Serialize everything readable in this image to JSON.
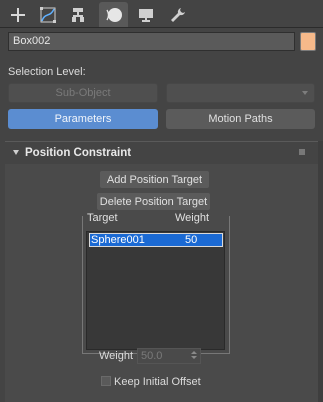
{
  "tabs": [
    {
      "name": "create",
      "icon": "plus-icon",
      "active": false
    },
    {
      "name": "modify",
      "icon": "modify-curve-icon",
      "active": false
    },
    {
      "name": "hierarchy",
      "icon": "hierarchy-icon",
      "active": false
    },
    {
      "name": "motion",
      "icon": "motion-icon",
      "active": true
    },
    {
      "name": "display",
      "icon": "display-monitor-icon",
      "active": false
    },
    {
      "name": "utilities",
      "icon": "wrench-icon",
      "active": false
    }
  ],
  "object": {
    "name": "Box002",
    "color": "#f6b98a"
  },
  "selection": {
    "label": "Selection Level:",
    "sub_object_button": "Sub-Object"
  },
  "mode_buttons": {
    "parameters": "Parameters",
    "motion_paths": "Motion Paths"
  },
  "rollout": {
    "title": "Position Constraint",
    "add_target_button": "Add Position Target",
    "delete_target_button": "Delete Position Target",
    "list_headers": {
      "target": "Target",
      "weight": "Weight"
    },
    "targets": [
      {
        "name": "Sphere001",
        "weight": "50",
        "selected": true
      }
    ],
    "weight_label": "Weight",
    "weight_value": "50.0",
    "keep_initial_offset_label": "Keep Initial Offset",
    "keep_initial_offset_checked": false
  },
  "colors": {
    "accent": "#5b8dd1",
    "selection": "#1b6ad4",
    "panel_bg": "#444444"
  }
}
